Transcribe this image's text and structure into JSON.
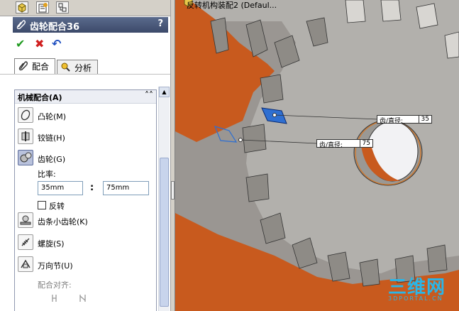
{
  "property_manager": {
    "title": "齿轮配合36",
    "help": "?",
    "actions": {
      "ok": "✔",
      "cancel": "✖",
      "undo": "↶"
    },
    "tabs": [
      {
        "label": "配合",
        "active": true
      },
      {
        "label": "分析",
        "active": false
      }
    ],
    "group": {
      "header": "机械配合(A)",
      "collapse": "˄˄",
      "mates": [
        {
          "label": "凸轮(M)",
          "icon": "cam-icon",
          "selected": false
        },
        {
          "label": "铰链(H)",
          "icon": "hinge-icon",
          "selected": false
        },
        {
          "label": "齿轮(G)",
          "icon": "gear-icon",
          "selected": true
        }
      ],
      "ratio_label": "比率:",
      "ratio_left": "35mm",
      "ratio_sep": ":",
      "ratio_right": "75mm",
      "reverse_label": "反转",
      "reverse_checked": false,
      "more_mates": [
        {
          "label": "齿条小齿轮(K)",
          "icon": "rack-pinion-icon"
        },
        {
          "label": "螺旋(S)",
          "icon": "screw-icon"
        },
        {
          "label": "万向节(U)",
          "icon": "universal-joint-icon"
        }
      ],
      "alignment_label": "配合对齐:"
    }
  },
  "viewport": {
    "tree_label": "反转机构装配2  (Defaul...",
    "dimensions": [
      {
        "label": "齿/直径:",
        "value": "35"
      },
      {
        "label": "齿/直径:",
        "value": "75"
      }
    ],
    "watermark": "三维网",
    "watermark_sub": "3DPORTAL.CN"
  },
  "colors": {
    "gear_orange": "#c85a1e",
    "gear_gray": "#b4b2ae",
    "selection_blue": "#2f6fd1",
    "title_bar": "#4a5878"
  }
}
